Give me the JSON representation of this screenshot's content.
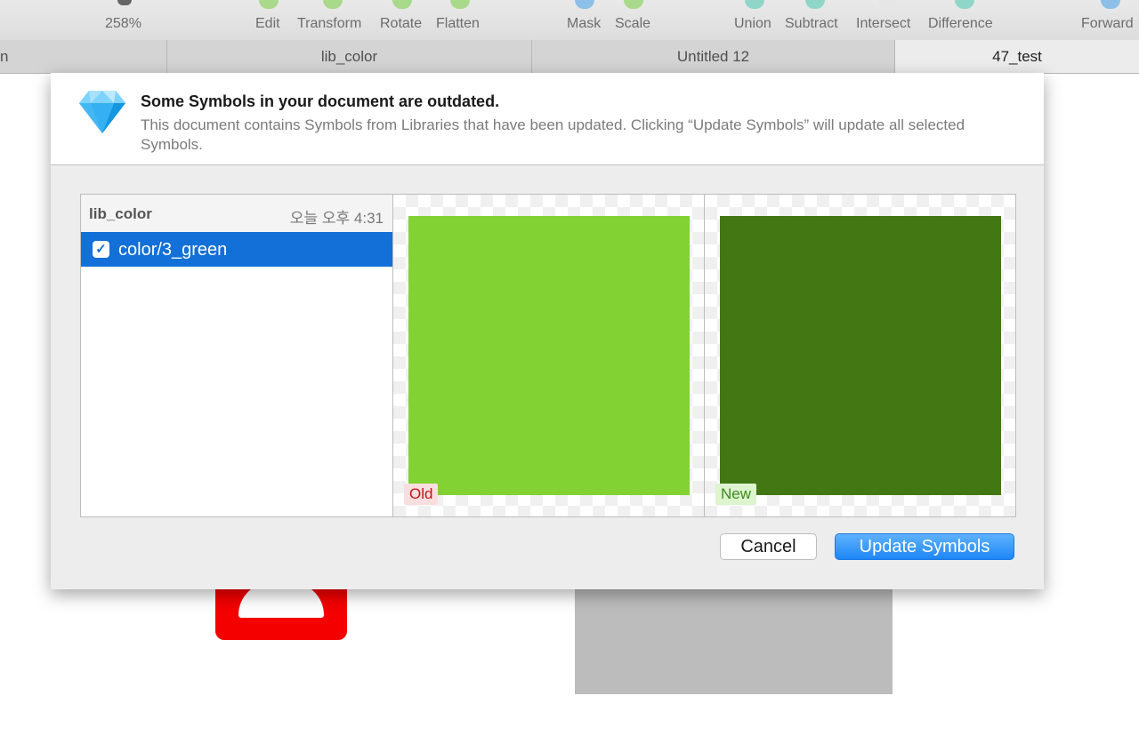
{
  "toolbar": {
    "zoom": "258%",
    "edit": "Edit",
    "transform": "Transform",
    "rotate": "Rotate",
    "flatten": "Flatten",
    "mask": "Mask",
    "scale": "Scale",
    "union": "Union",
    "subtract": "Subtract",
    "intersect": "Intersect",
    "difference": "Difference",
    "forward": "Forward"
  },
  "tabs": [
    {
      "label": "n"
    },
    {
      "label": "lib_color"
    },
    {
      "label": "Untitled 12"
    },
    {
      "label": "47_test"
    }
  ],
  "dialog": {
    "title": "Some Symbols in your document are outdated.",
    "message": "This document contains Symbols from Libraries that have been updated. Clicking “Update Symbols” will update all selected Symbols.",
    "library": {
      "name": "lib_color",
      "date": "오늘 오후 4:31"
    },
    "items": [
      {
        "label": "color/3_green",
        "checked": true,
        "check_glyph": "✓"
      }
    ],
    "preview": {
      "old_label": "Old",
      "new_label": "New",
      "old_color": "#82d234",
      "new_color": "#427713"
    },
    "cancel_label": "Cancel",
    "update_label": "Update Symbols"
  }
}
